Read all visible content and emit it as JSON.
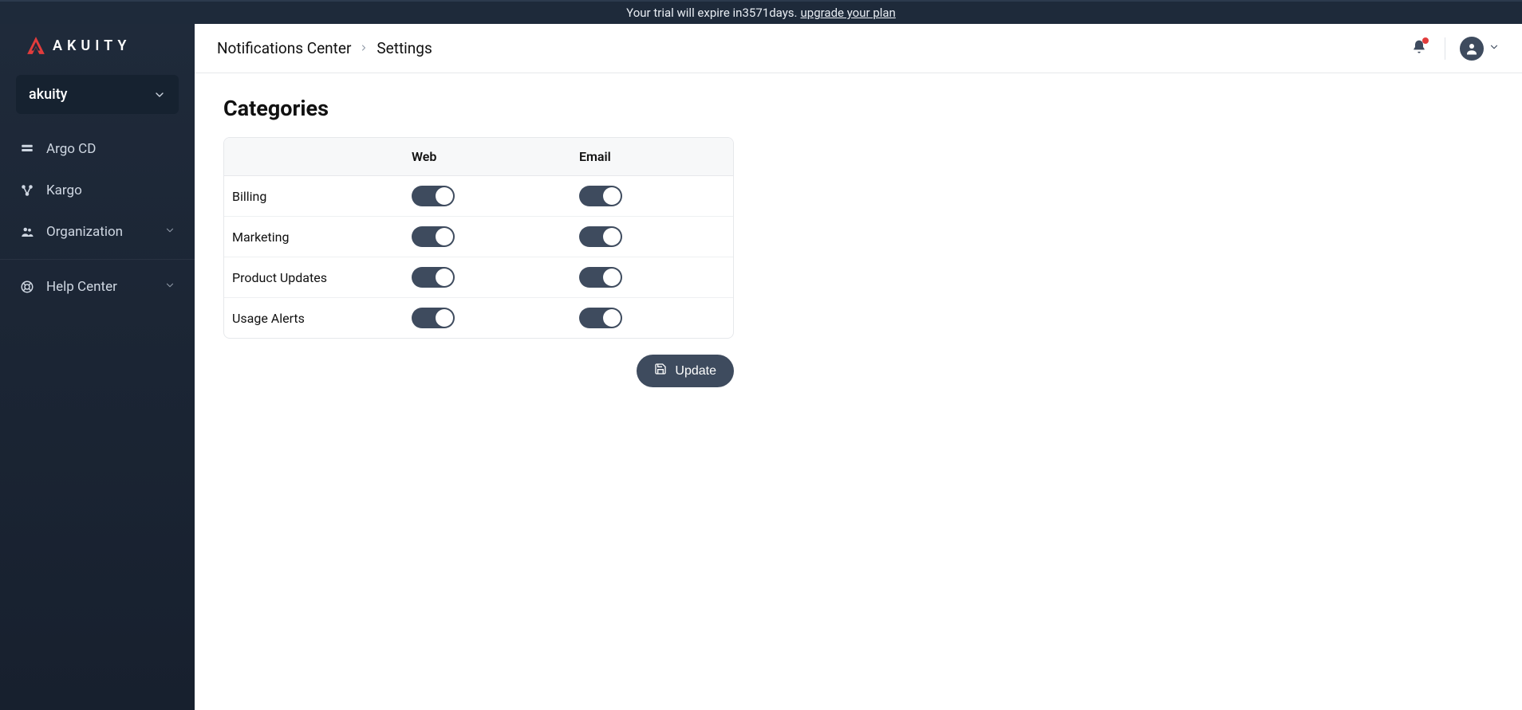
{
  "banner": {
    "text_prefix": "Your trial will expire in ",
    "days": "3571",
    "text_suffix": " days. ",
    "link_label": "upgrade your plan"
  },
  "brand": {
    "name": "AKUITY"
  },
  "org_selector": {
    "selected": "akuity"
  },
  "sidebar": {
    "items": [
      {
        "label": "Argo CD"
      },
      {
        "label": "Kargo"
      },
      {
        "label": "Organization"
      },
      {
        "label": "Help Center"
      }
    ]
  },
  "breadcrumb": {
    "parts": [
      {
        "label": "Notifications Center"
      },
      {
        "label": "Settings"
      }
    ]
  },
  "page": {
    "title": "Categories",
    "columns": {
      "col1": "",
      "col2": "Web",
      "col3": "Email"
    },
    "rows": [
      {
        "label": "Billing",
        "web": true,
        "email": true
      },
      {
        "label": "Marketing",
        "web": true,
        "email": true
      },
      {
        "label": "Product Updates",
        "web": true,
        "email": true
      },
      {
        "label": "Usage Alerts",
        "web": true,
        "email": true
      }
    ],
    "update_label": "Update"
  }
}
